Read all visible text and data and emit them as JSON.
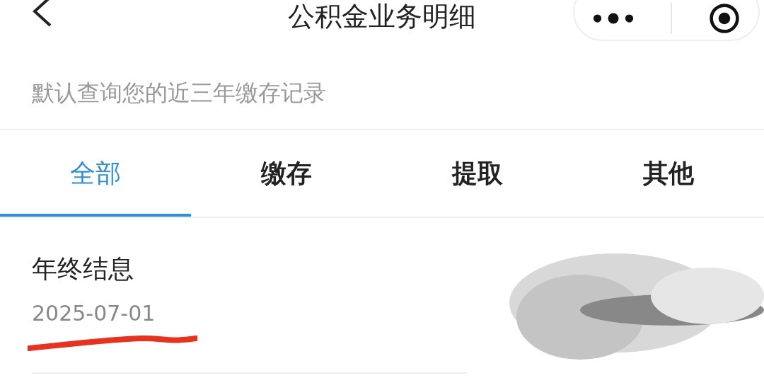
{
  "header": {
    "title": "公积金业务明细"
  },
  "notice": "默认查询您的近三年缴存记录",
  "tabs": [
    {
      "label": "全部",
      "selected": true
    },
    {
      "label": "缴存",
      "selected": false
    },
    {
      "label": "提取",
      "selected": false
    },
    {
      "label": "其他",
      "selected": false
    }
  ],
  "records": [
    {
      "title": "年终结息",
      "date": "2025-07-01"
    }
  ]
}
